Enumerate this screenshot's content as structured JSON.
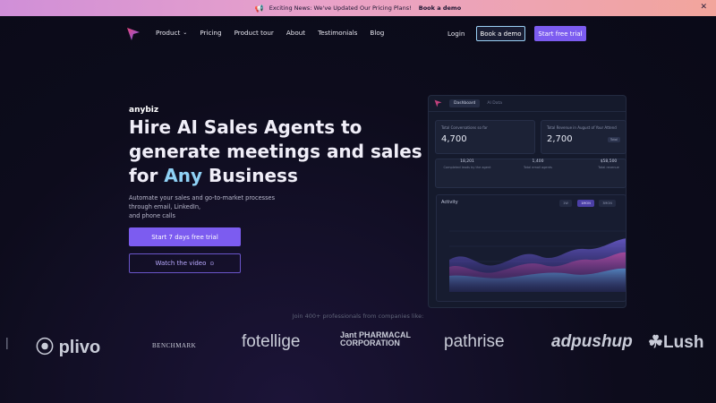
{
  "banner": {
    "text": "Exciting News: We've Updated Our Pricing Plans!",
    "cta": "Book a demo",
    "close": "✕"
  },
  "nav": {
    "items": [
      "Product",
      "Pricing",
      "Product tour",
      "About",
      "Testimonials",
      "Blog"
    ],
    "login": "Login",
    "book_demo": "Book a demo",
    "start_trial": "Start free trial"
  },
  "hero": {
    "brand": "anybiz",
    "headline_part1": "Hire AI Sales Agents to generate meetings and sales for ",
    "headline_accent": "Any",
    "headline_part2": " Business",
    "subtext_line1": "Automate your sales and go-to-market processes",
    "subtext_line2": "through email, LinkedIn,",
    "subtext_line3": "and phone calls",
    "primary_button": "Start 7 days free trial",
    "video_button": "Watch the video"
  },
  "dashboard": {
    "tabs": [
      "Dashboard",
      "AI Data"
    ],
    "card1_label": "Total Conversations so far",
    "card1_value": "4,700",
    "card2_label": "Total Revenue in August of Your Attend",
    "card2_value": "2,700",
    "card2_pill": "Total",
    "stats": [
      {
        "value": "18,201",
        "label": "Completed leads by the agent"
      },
      {
        "value": "1,400",
        "label": "Total email agents"
      },
      {
        "value": "$58,500",
        "label": "Total revenue"
      }
    ],
    "activity_title": "Activity",
    "ranges": [
      "1W",
      "1MON",
      "3MON",
      "1Y"
    ],
    "active_range": "1MON"
  },
  "logos_section": {
    "caption": "Join 400+ professionals from companies like:",
    "companies": [
      "plivo",
      "BENCHMARK",
      "fotellige",
      "Jant PHARMACAL CORPORATION",
      "pathrise",
      "adpushup",
      "Lush"
    ]
  },
  "colors": {
    "accent": "#7c5cf0",
    "highlight": "#8fd1f5",
    "background": "#0d0c1c"
  }
}
